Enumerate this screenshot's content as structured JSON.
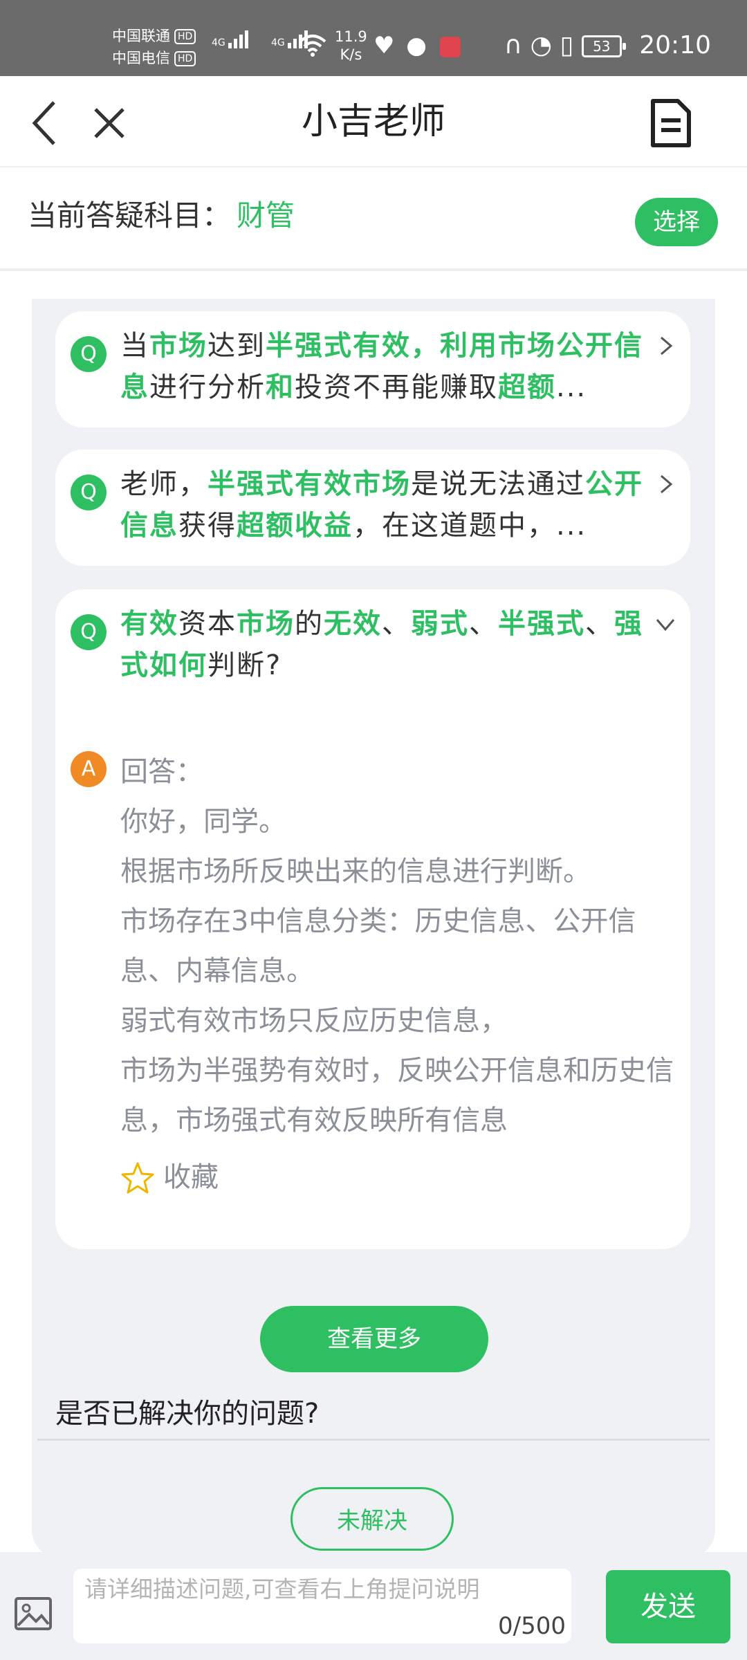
{
  "status_bar": {
    "carrier1": "中国联通",
    "carrier2": "中国电信",
    "hd_badge": "HD",
    "network_type": "4G",
    "speed_value": "11.9",
    "speed_unit": "K/s",
    "battery": "53",
    "time": "20:10"
  },
  "nav": {
    "title": "小吉老师"
  },
  "subject": {
    "label": "当前答疑科目：",
    "value": "财管",
    "select_label": "选择"
  },
  "questions": [
    {
      "badge": "Q",
      "segments": [
        {
          "t": "当",
          "h": false
        },
        {
          "t": "市场",
          "h": true
        },
        {
          "t": "达到",
          "h": false
        },
        {
          "t": "半强式有效，利用市场公开信息",
          "h": true
        },
        {
          "t": "进行分析",
          "h": false
        },
        {
          "t": "和",
          "h": true
        },
        {
          "t": "投资不再能赚取",
          "h": false
        },
        {
          "t": "超额",
          "h": true
        },
        {
          "t": "...",
          "h": false
        }
      ]
    },
    {
      "badge": "Q",
      "segments": [
        {
          "t": "老师，",
          "h": false
        },
        {
          "t": "半强式有效市场",
          "h": true
        },
        {
          "t": "是说无法通过",
          "h": false
        },
        {
          "t": "公开信息",
          "h": true
        },
        {
          "t": "获得",
          "h": false
        },
        {
          "t": "超额收益",
          "h": true
        },
        {
          "t": "，在这道题中，...",
          "h": false
        }
      ]
    },
    {
      "badge": "Q",
      "segments": [
        {
          "t": "有效",
          "h": true
        },
        {
          "t": "资本",
          "h": false
        },
        {
          "t": "市场",
          "h": true
        },
        {
          "t": "的",
          "h": false
        },
        {
          "t": "无效",
          "h": true
        },
        {
          "t": "、",
          "h": false
        },
        {
          "t": "弱式",
          "h": true
        },
        {
          "t": "、",
          "h": false
        },
        {
          "t": "半强式",
          "h": true
        },
        {
          "t": "、",
          "h": false
        },
        {
          "t": "强式如何",
          "h": true
        },
        {
          "t": "判断?",
          "h": false
        }
      ],
      "answer": {
        "badge": "A",
        "lines": [
          "回答：",
          "你好，同学。",
          "根据市场所反映出来的信息进行判断。",
          "市场存在3中信息分类：历史信息、公开信息、内幕信息。",
          "弱式有效市场只反应历史信息，",
          "市场为半强势有效时，反映公开信息和历史信息，市场强式有效反映所有信息"
        ],
        "favorite_label": "收藏"
      }
    }
  ],
  "more_label": "查看更多",
  "resolve_question": "是否已解决你的问题?",
  "unresolved_label": "未解决",
  "input": {
    "placeholder": "请详细描述问题,可查看右上角提问说明",
    "count": "0/500",
    "send_label": "发送"
  },
  "colors": {
    "accent": "#2fbf63",
    "answer_badge": "#f08a24",
    "answer_text": "#8b8f98",
    "panel_bg": "#f0f1f5",
    "status_bar": "#6b6b6b"
  },
  "icons": [
    "back-icon",
    "close-icon",
    "document-icon",
    "chevron-right-icon",
    "chevron-down-icon",
    "star-icon",
    "image-icon"
  ]
}
